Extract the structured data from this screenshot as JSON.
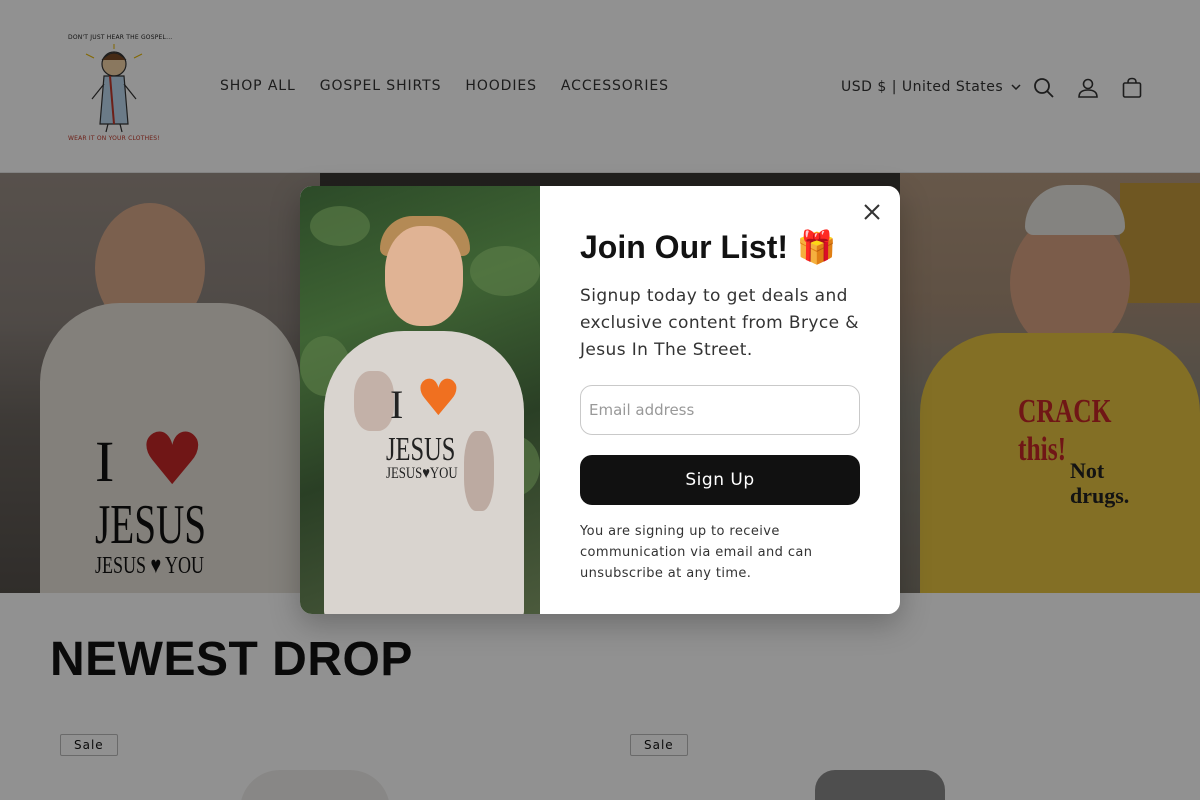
{
  "header": {
    "logo_tagline_top": "DON'T JUST HEAR THE GOSPEL...",
    "logo_tagline_bottom": "WEAR IT ON YOUR CLOTHES!",
    "nav": [
      "SHOP ALL",
      "GOSPEL SHIRTS",
      "HOODIES",
      "ACCESSORIES"
    ],
    "currency": "USD $ | United States",
    "icons": [
      "search-icon",
      "account-icon",
      "cart-icon"
    ]
  },
  "hero": {
    "left_shirt": {
      "line1": "I",
      "line2": "JESUS",
      "line3": "JESUS ♥ YOU"
    },
    "right_shirt": {
      "line1": "CRACK this!",
      "line2": "Not",
      "line3": "drugs."
    }
  },
  "popup": {
    "title": "Join Our List! 🎁",
    "subtitle": "Signup today to get deals and exclusive content from Bryce & Jesus In The Street.",
    "email_placeholder": "Email address",
    "signup_label": "Sign Up",
    "disclaimer": "You are signing up to receive communication via email and can unsubscribe at any time.",
    "hoodie": {
      "i": "I",
      "jesus": "JESUS",
      "you": "JESUS♥YOU"
    }
  },
  "section": {
    "title": "NEWEST DROP",
    "badges": [
      "Sale",
      "Sale"
    ]
  },
  "colors": {
    "accent": "#111111",
    "overlay": "rgba(0,0,0,0.43)"
  }
}
